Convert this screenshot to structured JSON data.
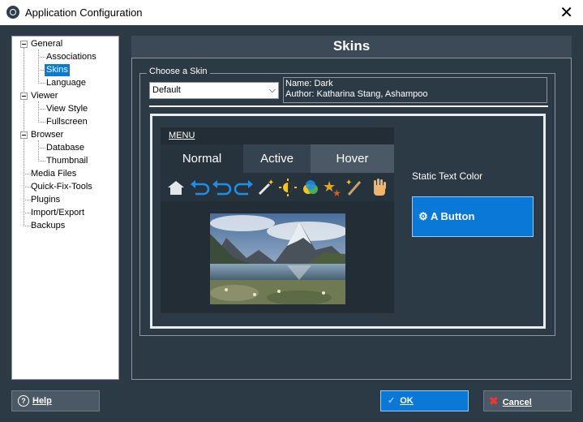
{
  "window": {
    "title": "Application Configuration",
    "close_label": "✕"
  },
  "tree": {
    "general": "General",
    "associations": "Associations",
    "skins": "Skins",
    "language": "Language",
    "viewer": "Viewer",
    "view_style": "View Style",
    "fullscreen": "Fullscreen",
    "browser": "Browser",
    "database": "Database",
    "thumbnail": "Thumbnail",
    "media_files": "Media Files",
    "quick_fix_tools": "Quick-Fix-Tools",
    "plugins": "Plugins",
    "import_export": "Import/Export",
    "backups": "Backups"
  },
  "panel": {
    "title": "Skins"
  },
  "skin": {
    "group_label": "Choose a Skin",
    "selected": "Default",
    "name_line": "Name: Dark",
    "author_line": "Author: Katharina Stang, Ashampoo"
  },
  "preview": {
    "menu_label": "MENU",
    "tabs": [
      "Normal",
      "Active",
      "Hover"
    ],
    "static_text_label": "Static Text Color",
    "button_label": "A Button",
    "colors": {
      "accent": "#0a78d7",
      "background": "#2b3a45",
      "panel": "#3b4a56",
      "menu": "#222d36"
    }
  },
  "footer": {
    "help": "Help",
    "ok": "OK",
    "cancel": "Cancel"
  }
}
